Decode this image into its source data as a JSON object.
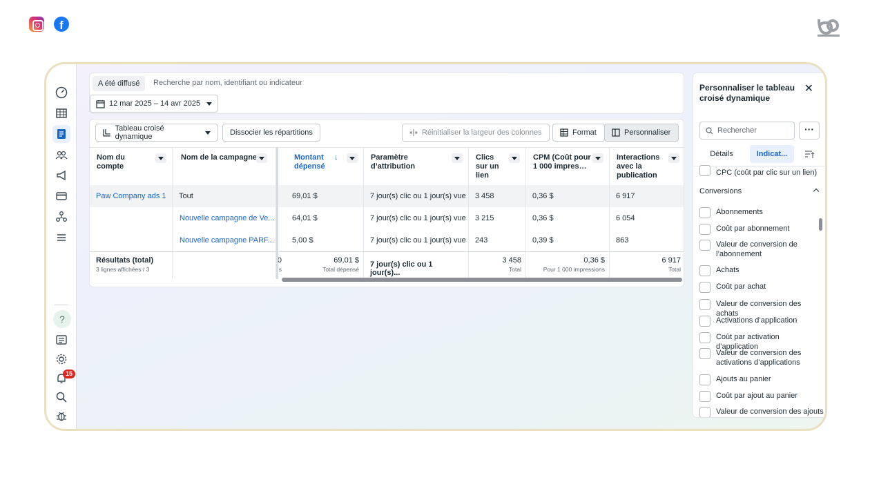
{
  "brand": {
    "top_icons": [
      "instagram-icon",
      "facebook-icon"
    ],
    "facebook_glyph": "f"
  },
  "nav": {
    "icons": [
      "dashboard-icon",
      "table-icon",
      "reports-icon",
      "audiences-icon",
      "megaphone-icon",
      "billing-icon",
      "business-icon",
      "menu-icon",
      "help-icon",
      "news-icon",
      "settings-icon",
      "notifications-icon",
      "search-icon",
      "bug-icon"
    ],
    "help_glyph": "?",
    "notification_count": "15"
  },
  "filter": {
    "chip": "A été diffusé",
    "search_placeholder": "Recherche par nom, identifiant ou indicateur",
    "date_range": "12 mar 2025 – 14 avr 2025"
  },
  "toolbar": {
    "view_select": "Tableau croisé dynamique",
    "split_button": "Dissocier les répartitions",
    "reset_width": "Réinitialiser la largeur des colonnes",
    "format": "Format",
    "customize": "Personnaliser"
  },
  "table": {
    "headers": {
      "account": "Nom du compte",
      "campaign": "Nom de la campagne",
      "spend": "Montant dépensé",
      "spend_sort_glyph": "↓",
      "attribution": "Paramètre d’attribution",
      "clicks": "Clics sur un lien",
      "cpm": "CPM (Coût pour 1 000 impres…",
      "engagement": "Interactions avec la publication"
    },
    "rows": [
      {
        "account": "Paw Company ads 1",
        "campaign": "Tout",
        "spend": "69,01 $",
        "attribution": "7 jour(s) clic ou 1 jour(s) vue",
        "clicks": "3 458",
        "cpm": "0,36 $",
        "engagement": "6 917"
      },
      {
        "account": "",
        "campaign": "Nouvelle campagne de Ve...",
        "spend": "64,01 $",
        "attribution": "7 jour(s) clic ou 1 jour(s) vue",
        "clicks": "3 215",
        "cpm": "0,36 $",
        "engagement": "6 054"
      },
      {
        "account": "",
        "campaign": "Nouvelle campagne PARF...",
        "spend": "5,00 $",
        "attribution": "7 jour(s) clic ou 1 jour(s) vue",
        "clicks": "243",
        "cpm": "0,39 $",
        "engagement": "863"
      }
    ],
    "totals": {
      "label": "Résultats (total)",
      "sub": "3 lignes affichées / 3",
      "clipped_value": "0",
      "clipped_sub": "s",
      "spend": "69,01 $",
      "spend_sub": "Total dépensé",
      "attribution": "7 jour(s) clic ou 1 jour(s)...",
      "clicks": "3 458",
      "clicks_sub": "Total",
      "cpm": "0,36 $",
      "cpm_sub": "Pour 1 000 impressions",
      "engagement": "6 917",
      "engagement_sub": "Total"
    }
  },
  "panel": {
    "title": "Personnaliser le tableau croisé dynamique",
    "close_glyph": "✕",
    "search_placeholder": "Rechercher",
    "more_glyph": "···",
    "tab_details": "Détails",
    "tab_metrics": "Indicat...",
    "cpc_item": "CPC (coût par clic sur un lien)",
    "section": "Conversions",
    "items": [
      "Abonnements",
      "Coût par abonnement",
      "Valeur de conversion de l’abonnement",
      "Achats",
      "Coût par achat",
      "Valeur de conversion des achats",
      "Activations d’application",
      "Coût par activation d’application",
      "Valeur de conversion des activations d’applications",
      "Ajouts au panier",
      "Coût par ajout au panier",
      "Valeur de conversion des ajouts au panier"
    ]
  }
}
